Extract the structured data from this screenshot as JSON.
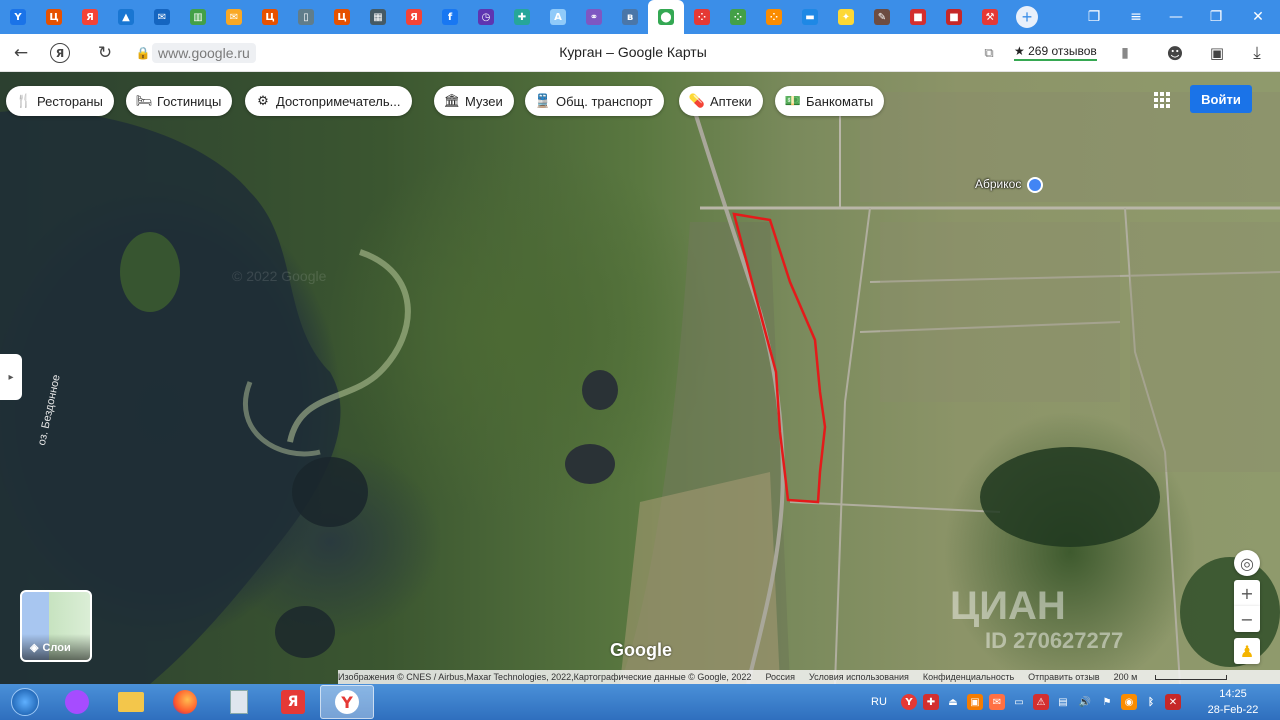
{
  "browser": {
    "domain": "www.google.ru",
    "page_title": "Курган – Google Карты",
    "reviews_label": "★ 269 отзывов",
    "tabs": [
      {
        "icon": "bookmark-icon",
        "color": "#1a73e8",
        "glyph": "Y"
      },
      {
        "icon": "cian-icon",
        "color": "#e65100",
        "glyph": "Ц"
      },
      {
        "icon": "yandex-icon",
        "color": "#f44336",
        "glyph": "Я"
      },
      {
        "icon": "arrow-icon",
        "color": "#1976d2",
        "glyph": "▲"
      },
      {
        "icon": "mail-icon",
        "color": "#1565c0",
        "glyph": "✉"
      },
      {
        "icon": "sheet-icon",
        "color": "#43a047",
        "glyph": "▥"
      },
      {
        "icon": "envelope-icon",
        "color": "#f9a825",
        "glyph": "✉"
      },
      {
        "icon": "cian-icon",
        "color": "#e65100",
        "glyph": "Ц"
      },
      {
        "icon": "doc-icon",
        "color": "#607d8b",
        "glyph": "▯"
      },
      {
        "icon": "cian-icon",
        "color": "#e65100",
        "glyph": "Ц"
      },
      {
        "icon": "building-icon",
        "color": "#455a64",
        "glyph": "▦"
      },
      {
        "icon": "yandex-icon",
        "color": "#f44336",
        "glyph": "Я"
      },
      {
        "icon": "facebook-icon",
        "color": "#1877f2",
        "glyph": "f"
      },
      {
        "icon": "clock-icon",
        "color": "#5e35b1",
        "glyph": "◷"
      },
      {
        "icon": "plus-icon",
        "color": "#26a69a",
        "glyph": "✚"
      },
      {
        "icon": "ar-icon",
        "color": "#90caf9",
        "glyph": "A"
      },
      {
        "icon": "chain-icon",
        "color": "#7e57c2",
        "glyph": "⚭"
      },
      {
        "icon": "vk-icon",
        "color": "#4a76a8",
        "glyph": "в"
      },
      {
        "icon": "maps-icon",
        "color": "#34a853",
        "glyph": "⬤",
        "active": true
      },
      {
        "icon": "dots-icon",
        "color": "#e53935",
        "glyph": "⁘"
      },
      {
        "icon": "dots-icon",
        "color": "#43a047",
        "glyph": "⁘"
      },
      {
        "icon": "dots-icon",
        "color": "#fb8c00",
        "glyph": "⁘"
      },
      {
        "icon": "flag-icon",
        "color": "#1e88e5",
        "glyph": "▬"
      },
      {
        "icon": "emblem-icon",
        "color": "#fdd835",
        "glyph": "✦"
      },
      {
        "icon": "pen-icon",
        "color": "#6d4c41",
        "glyph": "✎"
      },
      {
        "icon": "square-icon",
        "color": "#d32f2f",
        "glyph": "■"
      },
      {
        "icon": "square-icon",
        "color": "#c62828",
        "glyph": "■"
      },
      {
        "icon": "tool-icon",
        "color": "#e53935",
        "glyph": "⚒"
      }
    ]
  },
  "map": {
    "categories": [
      {
        "label": "Рестораны",
        "icon": "restaurant-icon",
        "glyph": "🍴"
      },
      {
        "label": "Гостиницы",
        "icon": "hotel-icon",
        "glyph": "🛏"
      },
      {
        "label": "Достопримечатель...",
        "icon": "attractions-icon",
        "glyph": "⚙"
      },
      {
        "label": "Музеи",
        "icon": "museum-icon",
        "glyph": "🏛"
      },
      {
        "label": "Общ. транспорт",
        "icon": "transit-icon",
        "glyph": "🚆"
      },
      {
        "label": "Аптеки",
        "icon": "pharmacy-icon",
        "glyph": "💊"
      },
      {
        "label": "Банкоматы",
        "icon": "atm-icon",
        "glyph": "💵"
      }
    ],
    "login_label": "Войти",
    "layers_label": "Слои",
    "place_label": "Абрикос",
    "lake_label": "оз. Бездонное",
    "google_logo": "Google",
    "watermark_text": "ЦИАН",
    "watermark_id": "ID 270627277",
    "faint_watermark": "© 2022 Google",
    "attribution": [
      "Изображения © CNES / Airbus,Maxar Technologies, 2022,Картографические данные © Google, 2022",
      "Россия",
      "Условия использования",
      "Конфиденциальность",
      "Отправить отзыв",
      "200 м"
    ]
  },
  "taskbar": {
    "language": "RU",
    "time": "14:25",
    "date": "28-Feb-22"
  }
}
